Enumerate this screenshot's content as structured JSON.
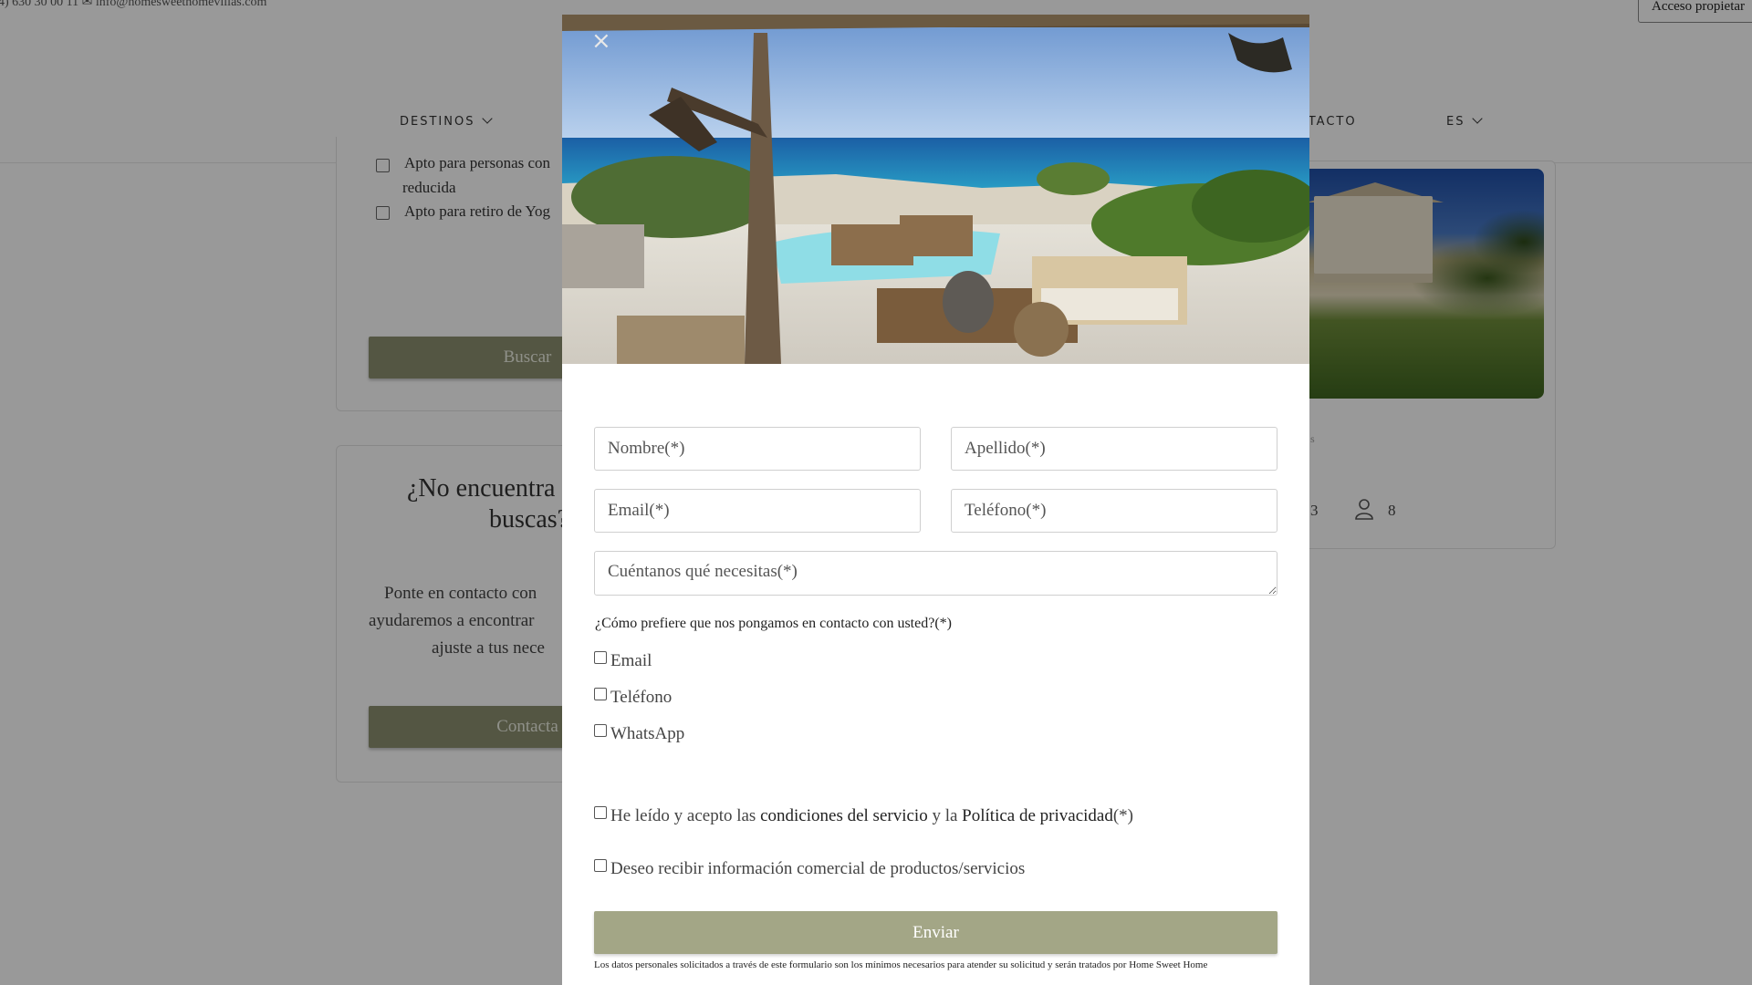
{
  "topbar": {
    "contact_text": "4) 630 30 00 11   ✉ info@homesweethomevillas.com",
    "owner_access": "Acceso propietar"
  },
  "nav": {
    "destinos": "DESTINOS",
    "contacto": "NTACTO",
    "language": "ES"
  },
  "filters": {
    "item1_line1": "Apto para personas con",
    "item1_line2": "reducida",
    "item2": "Apto para retiro de Yog",
    "search_button": "Buscar"
  },
  "help_card": {
    "title_line1": "¿No encuentra",
    "title_line2": "buscas?",
    "text_line1": "Ponte en contacto con",
    "text_line2": "ayudaremos a encontrar",
    "text_line3": "ajuste a tus nece",
    "button": "Contacta"
  },
  "property": {
    "meta": "s",
    "rooms": "3",
    "guests": "8"
  },
  "modal": {
    "close": "×",
    "fields": {
      "nombre": "Nombre(*)",
      "apellido": "Apellido(*)",
      "email": "Email(*)",
      "telefono": "Teléfono(*)",
      "mensaje": "Cuéntanos qué necesitas(*)"
    },
    "contact_question": "¿Cómo prefiere que nos pongamos en contacto con usted?(*)",
    "contact_options": [
      "Email",
      "Teléfono",
      "WhatsApp"
    ],
    "terms": {
      "prefix": "He leído y acepto las ",
      "conditions_link": "condiciones del servicio",
      "middle": " y la ",
      "privacy_link": "Política de privacidad",
      "suffix": "(*)"
    },
    "marketing": "Deseo recibir información comercial de productos/servicios",
    "submit": "Enviar",
    "legal": "Los datos personales solicitados a través de este formulario son los mínimos necesarios para atender su solicitud y serán tratados por Home Sweet Home"
  },
  "colors": {
    "olive_button": "#8d9070",
    "submit_button": "#a3a686"
  }
}
